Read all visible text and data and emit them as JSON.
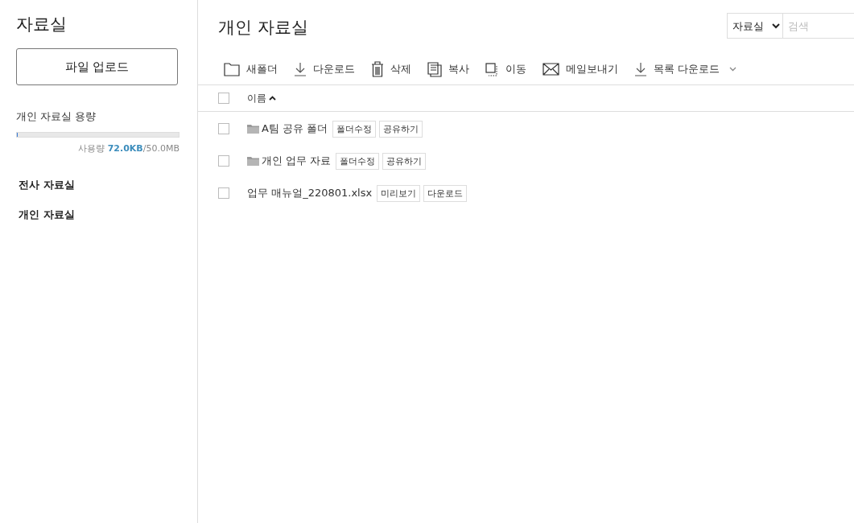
{
  "sidebar": {
    "title": "자료실",
    "upload_button": "파일 업로드",
    "storage": {
      "label": "개인 자료실 용량",
      "level": 0.005,
      "usage_label": "사용량",
      "used": "72.0KB",
      "total": "/50.0MB"
    },
    "items": [
      "전사 자료실",
      "개인 자료실"
    ]
  },
  "main": {
    "title": "개인 자료실",
    "search": {
      "scope": "자료실",
      "placeholder": "검색"
    },
    "toolbar": [
      {
        "kind": "folder",
        "label": "새폴더"
      },
      {
        "kind": "download",
        "label": "다운로드"
      },
      {
        "kind": "trash",
        "label": "삭제"
      },
      {
        "kind": "copy",
        "label": "복사"
      },
      {
        "kind": "move",
        "label": "이동"
      },
      {
        "kind": "mail",
        "label": "메일보내기"
      },
      {
        "kind": "download",
        "label": "목록 다운로드",
        "menu": true
      }
    ],
    "table": {
      "header": {
        "checked": false,
        "column": "이름"
      },
      "rows": [
        {
          "kind": "folder",
          "checked": false,
          "name": "A팀 공유 폴더",
          "actions": [
            "폴더수정",
            "공유하기"
          ]
        },
        {
          "kind": "folder",
          "checked": false,
          "name": "개인 업무 자료",
          "actions": [
            "폴더수정",
            "공유하기"
          ]
        },
        {
          "kind": "file",
          "checked": false,
          "name": "업무 매뉴얼_220801.xlsx",
          "actions": [
            "미리보기",
            "다운로드"
          ]
        }
      ]
    }
  }
}
